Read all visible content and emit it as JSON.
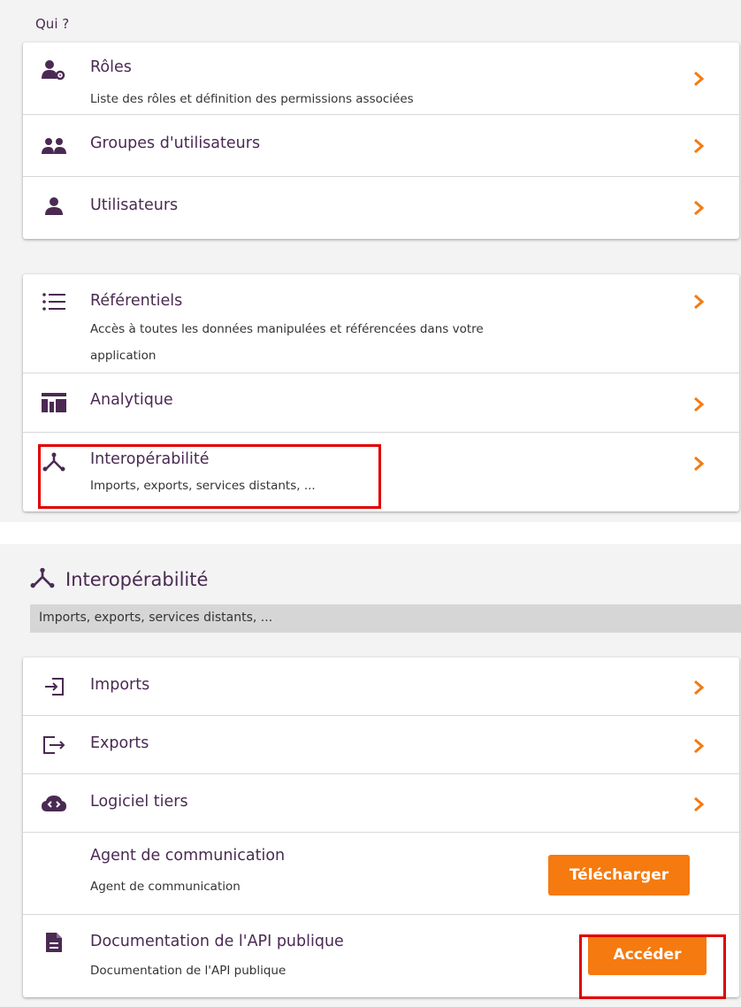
{
  "who": {
    "label": "Qui ?",
    "items": [
      {
        "title": "Rôles",
        "description": "Liste des rôles et définition des permissions associées",
        "icon": "user-gear-icon"
      },
      {
        "title": "Groupes d'utilisateurs",
        "icon": "users-group-icon"
      },
      {
        "title": "Utilisateurs",
        "icon": "user-icon"
      }
    ]
  },
  "data_section": {
    "items": [
      {
        "title": "Référentiels",
        "description_line1": "Accès à toutes les données manipulées et référencées dans votre",
        "description_line2": "application",
        "icon": "list-icon"
      },
      {
        "title": "Analytique",
        "icon": "analytics-icon"
      },
      {
        "title": "Interopérabilité",
        "description": "Imports, exports, services distants, ...",
        "icon": "interop-icon"
      }
    ]
  },
  "interop": {
    "title": "Interopérabilité",
    "subtitle": "Imports, exports, services distants, ...",
    "items": [
      {
        "title": "Imports",
        "icon": "import-icon"
      },
      {
        "title": "Exports",
        "icon": "export-icon"
      },
      {
        "title": "Logiciel tiers",
        "icon": "cloud-icon"
      },
      {
        "title": "Agent de communication",
        "description": "Agent de communication",
        "button": "Télécharger"
      },
      {
        "title": "Documentation de l'API publique",
        "description": "Documentation de l'API publique",
        "button": "Accéder",
        "icon": "document-icon"
      }
    ]
  },
  "colors": {
    "accent": "#f57a10",
    "title": "#4a2a52",
    "highlight": "#e00000"
  }
}
